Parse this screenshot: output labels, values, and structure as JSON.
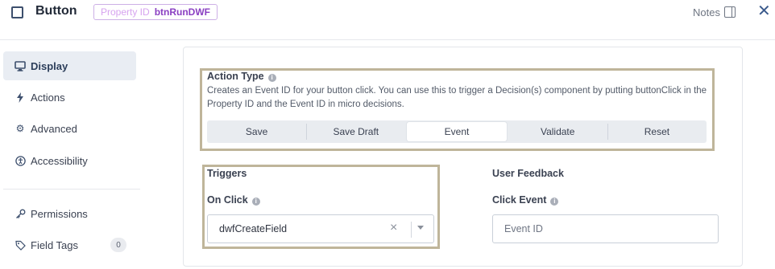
{
  "header": {
    "title": "Button",
    "property_id_label": "Property ID",
    "property_id_value": "btnRunDWF",
    "notes_label": "Notes",
    "close_icon": "close-icon"
  },
  "sidebar": {
    "items": [
      {
        "label": "Display",
        "icon": "monitor-icon",
        "active": true
      },
      {
        "label": "Actions",
        "icon": "lightning-icon"
      },
      {
        "label": "Advanced",
        "icon": "gear-icon"
      },
      {
        "label": "Accessibility",
        "icon": "accessibility-icon"
      },
      {
        "label": "Permissions",
        "icon": "key-icon"
      },
      {
        "label": "Field Tags",
        "icon": "tag-icon",
        "count": "0"
      }
    ]
  },
  "action_type": {
    "title": "Action Type",
    "description": "Creates an Event ID for your button click. You can use this to trigger a Decision(s) component by putting buttonClick in the Property ID and the Event ID in micro decisions.",
    "options": [
      "Save",
      "Save Draft",
      "Event",
      "Validate",
      "Reset"
    ],
    "selected": "Event"
  },
  "triggers": {
    "title": "Triggers",
    "on_click_label": "On Click",
    "on_click_value": "dwfCreateField"
  },
  "user_feedback": {
    "title": "User Feedback",
    "click_event_label": "Click Event",
    "click_event_placeholder": "Event ID",
    "click_event_value": ""
  },
  "colors": {
    "accent": "#8a3fc2",
    "highlight_border": "#bfb59a",
    "active_nav_bg": "#e9edf3"
  }
}
